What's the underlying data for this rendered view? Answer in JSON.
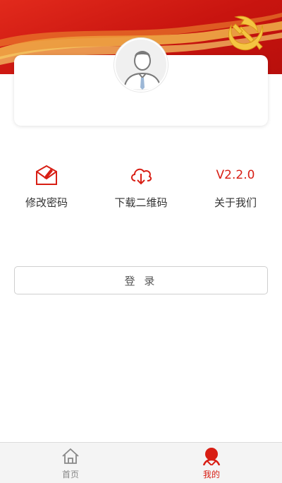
{
  "colors": {
    "primary_red": "#d81e14",
    "tab_inactive": "#888888"
  },
  "profile": {
    "avatar_icon": "user-avatar-icon"
  },
  "menu": {
    "items": [
      {
        "label": "修改密码",
        "icon": "envelope-edit-icon"
      },
      {
        "label": "下载二维码",
        "icon": "cloud-download-icon"
      },
      {
        "label": "关于我们",
        "version": "V2.2.0"
      }
    ]
  },
  "login": {
    "label": "登 录"
  },
  "tabbar": {
    "items": [
      {
        "label": "首页",
        "icon": "home-icon",
        "active": false
      },
      {
        "label": "我的",
        "icon": "user-icon",
        "active": true
      }
    ]
  }
}
